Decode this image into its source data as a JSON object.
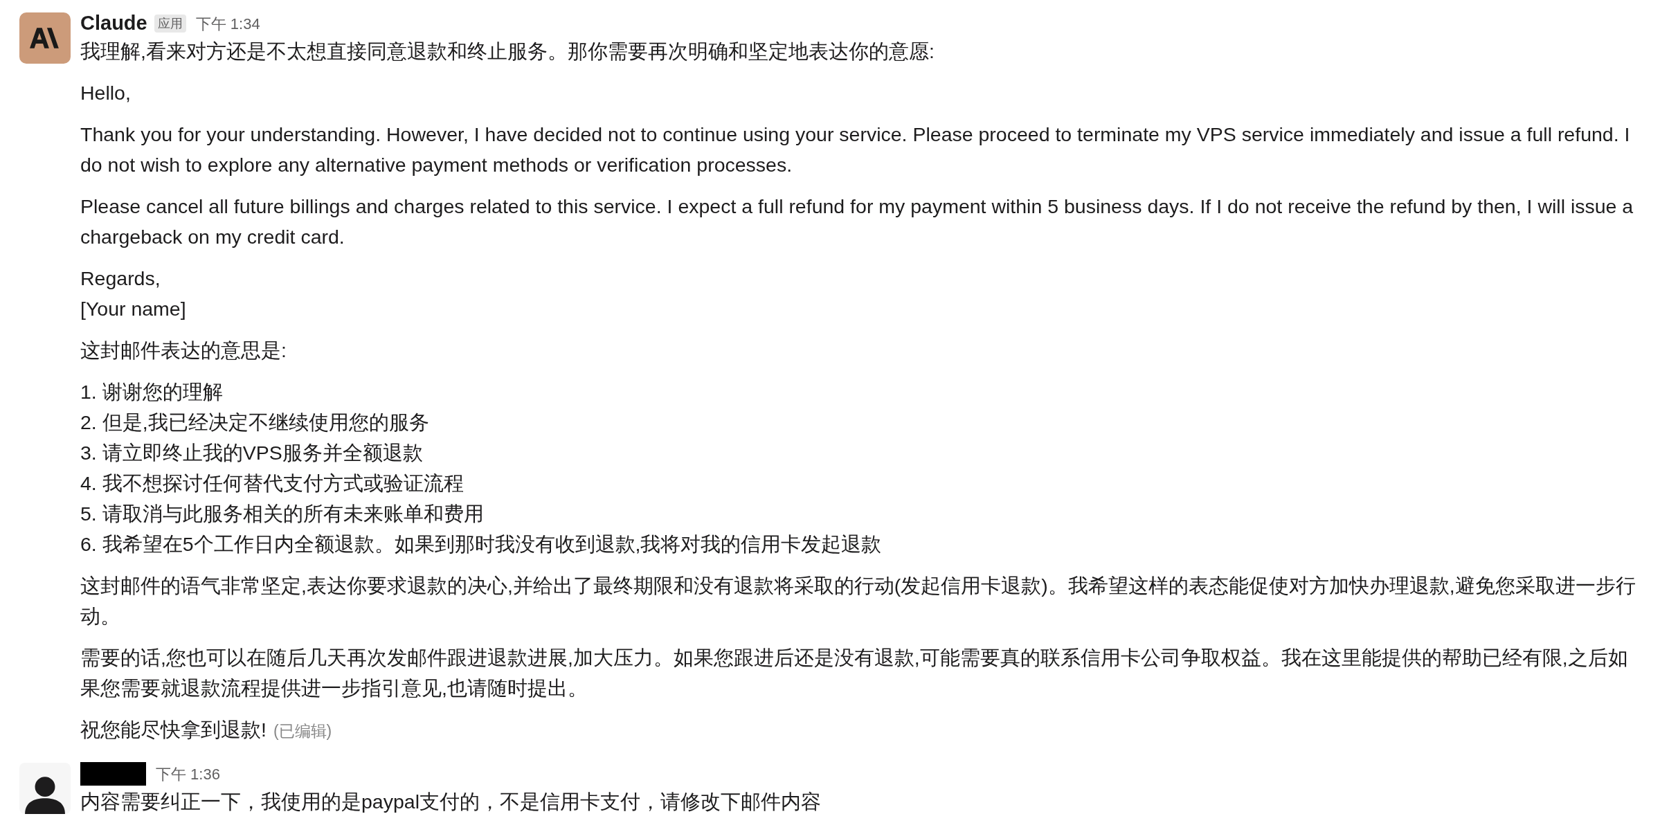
{
  "messages": [
    {
      "avatar": {
        "kind": "logo"
      },
      "author": "Claude",
      "redacted": false,
      "badge": "应用",
      "time": "下午 1:34",
      "blocks": [
        {
          "lines": [
            "我理解,看来对方还是不太想直接同意退款和终止服务。那你需要再次明确和坚定地表达你的意愿:"
          ]
        },
        {
          "lines": [
            "Hello,"
          ]
        },
        {
          "lines": [
            "Thank you for your understanding. However, I have decided not to continue using your service. Please proceed to terminate my VPS service immediately and issue a full refund. I do not wish to explore any alternative payment methods or verification processes."
          ]
        },
        {
          "lines": [
            "Please cancel all future billings and charges related to this service. I expect a full refund for my payment within 5 business days. If I do not receive the refund by then, I will issue a chargeback on my credit card."
          ]
        },
        {
          "lines": [
            "Regards,",
            "[Your name]"
          ]
        },
        {
          "lines": [
            "这封邮件表达的意思是:"
          ]
        },
        {
          "lines": [
            "1. 谢谢您的理解",
            "2. 但是,我已经决定不继续使用您的服务",
            "3. 请立即终止我的VPS服务并全额退款",
            "4. 我不想探讨任何替代支付方式或验证流程",
            "5. 请取消与此服务相关的所有未来账单和费用",
            "6. 我希望在5个工作日内全额退款。如果到那时我没有收到退款,我将对我的信用卡发起退款"
          ]
        },
        {
          "lines": [
            "这封邮件的语气非常坚定,表达你要求退款的决心,并给出了最终期限和没有退款将采取的行动(发起信用卡退款)。我希望这样的表态能促使对方加快办理退款,避免您采取进一步行动。"
          ]
        },
        {
          "lines": [
            "需要的话,您也可以在随后几天再次发邮件跟进退款进展,加大压力。如果您跟进后还是没有退款,可能需要真的联系信用卡公司争取权益。我在这里能提供的帮助已经有限,之后如果您需要就退款流程提供进一步指引意见,也请随时提出。"
          ]
        },
        {
          "lines": [
            "祝您能尽快拿到退款!"
          ],
          "edited": "(已编辑)"
        }
      ]
    },
    {
      "avatar": {
        "kind": "person"
      },
      "redacted": true,
      "time": "下午 1:36",
      "blocks": [
        {
          "lines": [
            "内容需要纠正一下，我使用的是paypal支付的，不是信用卡支付，请修改下邮件内容"
          ]
        }
      ]
    }
  ]
}
